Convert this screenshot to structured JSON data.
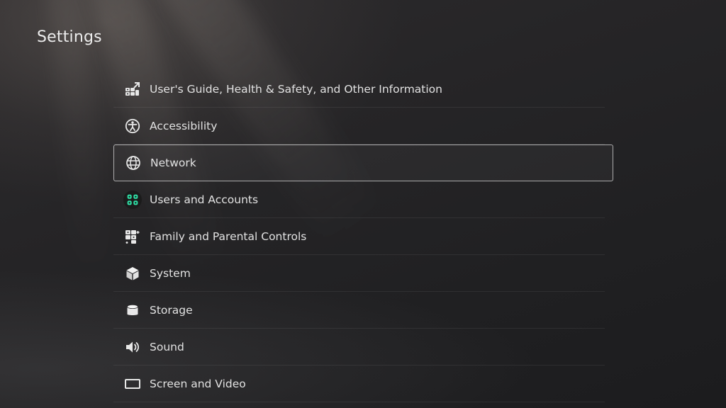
{
  "page": {
    "title": "Settings"
  },
  "menu": {
    "selected_index": 2,
    "items": [
      {
        "label": "User's Guide, Health & Safety, and Other Information",
        "icon": "guide-icon"
      },
      {
        "label": "Accessibility",
        "icon": "accessibility-icon"
      },
      {
        "label": "Network",
        "icon": "globe-icon"
      },
      {
        "label": "Users and Accounts",
        "icon": "users-accounts-icon"
      },
      {
        "label": "Family and Parental Controls",
        "icon": "family-icon"
      },
      {
        "label": "System",
        "icon": "cube-icon"
      },
      {
        "label": "Storage",
        "icon": "storage-icon"
      },
      {
        "label": "Sound",
        "icon": "speaker-icon"
      },
      {
        "label": "Screen and Video",
        "icon": "screen-icon"
      }
    ]
  },
  "colors": {
    "background": "#212124",
    "text": "#e2e2e2",
    "selection_border": "#d7d7d7",
    "users_icon_bg": "#1b1b1b",
    "users_icon_accent": "#2ee0a6"
  }
}
